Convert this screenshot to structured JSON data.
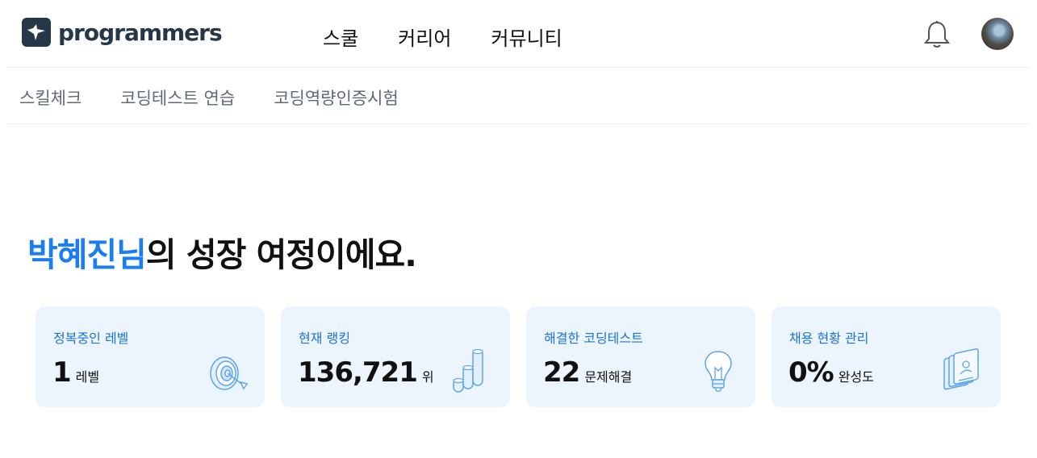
{
  "header": {
    "logo_text": "programmers",
    "nav": [
      "스쿨",
      "커리어",
      "커뮤니티"
    ],
    "icons": [
      "bell-icon",
      "avatar"
    ]
  },
  "subnav": {
    "items": [
      "스킬체크",
      "코딩테스트 연습",
      "코딩역량인증시험"
    ]
  },
  "hero": {
    "name": "박혜진님",
    "rest": "의 성장 여정이에요."
  },
  "cards": [
    {
      "title": "정복중인 레벨",
      "value": "1",
      "unit": "레벨",
      "icon": "target-icon"
    },
    {
      "title": "현재 랭킹",
      "value": "136,721",
      "unit": "위",
      "icon": "ranking-bars-icon"
    },
    {
      "title": "해결한 코딩테스트",
      "value": "22",
      "unit": "문제해결",
      "icon": "lightbulb-icon"
    },
    {
      "title": "채용 현황 관리",
      "value": "0%",
      "unit": "완성도",
      "icon": "resume-cards-icon"
    }
  ],
  "colors": {
    "accent": "#1a7df0",
    "card_bg": "#ecf4fd",
    "logo": "#263747"
  }
}
